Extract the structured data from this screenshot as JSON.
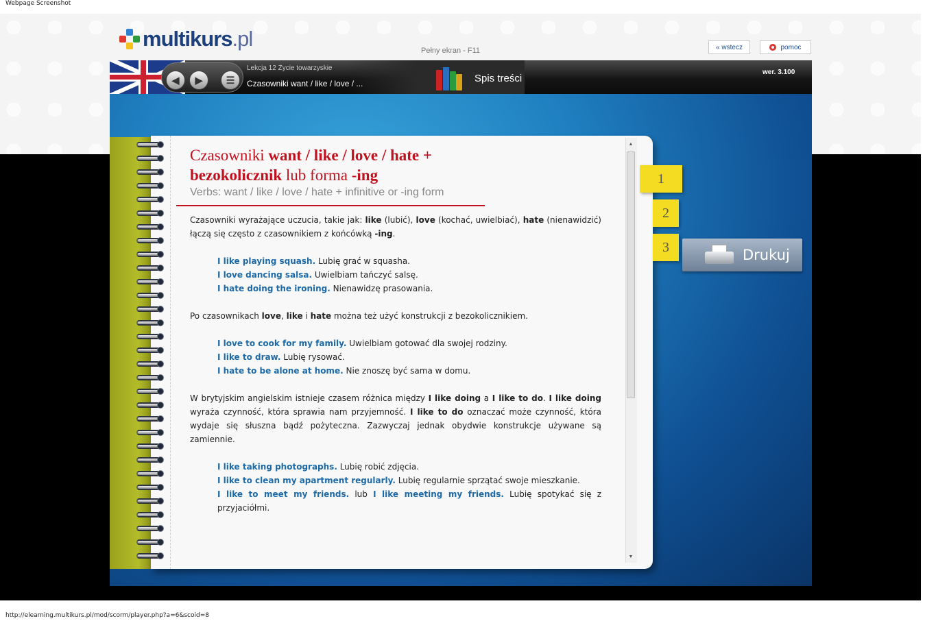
{
  "caption": {
    "top": "Webpage Screenshot",
    "bottom": "http://elearning.multikurs.pl/mod/scorm/player.php?a=6&scoid=8"
  },
  "header": {
    "logo_main": "multikurs",
    "logo_suffix": ".pl",
    "fullscreen_hint": "Pełny ekran - F11",
    "back_label": "« wstecz",
    "help_label": "pomoc"
  },
  "toolbar": {
    "lesson": "Lekcja 12 Życie towarzyskie",
    "topic": "Czasowniki want / like / love / ...",
    "toc_label": "Spis treści",
    "version": "wer. 3.100",
    "prev_icon": "arrow-left-icon",
    "next_icon": "arrow-right-icon",
    "menu_icon": "list-icon"
  },
  "content": {
    "title_part1": "Czasowniki ",
    "title_bold1": "want / like / love / hate + bezokolicznik",
    "title_part2": " lub forma ",
    "title_bold2": "-ing",
    "subtitle": "Verbs: want / like / love / hate + infinitive or -ing form",
    "intro": {
      "t1": "Czasowniki wyrażające uczucia, takie jak: ",
      "b1": "like",
      "t2": " (lubić), ",
      "b2": "love",
      "t3": " (kochać, uwielbiać), ",
      "b3": "hate",
      "t4": " (nienawidzić) łączą się często z czasownikiem z końcówką ",
      "b4": "-ing",
      "t5": "."
    },
    "examples1": [
      {
        "en": "I like playing squash.",
        "pl": " Lubię grać w squasha."
      },
      {
        "en": "I love dancing salsa.",
        "pl": " Uwielbiam tańczyć salsę."
      },
      {
        "en": "I hate doing the ironing.",
        "pl": " Nienawidzę prasowania."
      }
    ],
    "para2": {
      "t1": "Po czasownikach ",
      "b1": "love",
      "t2": ", ",
      "b2": "like",
      "t3": " i ",
      "b3": "hate",
      "t4": " można też użyć konstrukcji z bezokolicznikiem."
    },
    "examples2": [
      {
        "en": "I love to cook for my family.",
        "pl": " Uwielbiam gotować dla swojej rodziny."
      },
      {
        "en": "I like to draw.",
        "pl": " Lubię rysować."
      },
      {
        "en": "I hate to be alone at home.",
        "pl": " Nie znoszę być sama w domu."
      }
    ],
    "para3": {
      "t1": "W brytyjskim angielskim istnieje czasem różnica między ",
      "b1": "I like doing",
      "t2": " a ",
      "b2": "I like to do",
      "t3": ". ",
      "b3": "I like doing",
      "t4": " wyraża czynność, która sprawia nam przyjemność. ",
      "b4": "I like to do",
      "t5": " oznaczać może czynność, która wydaje się słuszna bądź pożyteczna. Zazwyczaj jednak obydwie konstrukcje używane są zamiennie."
    },
    "examples3": [
      {
        "en": "I like taking photographs.",
        "pl": " Lubię robić zdjęcia."
      },
      {
        "en": "I like to clean my apartment regularly.",
        "pl": " Lubię regularnie sprzątać swoje mieszkanie."
      }
    ],
    "example_last": {
      "en1": "I like to meet my friends.",
      "mid": " lub ",
      "en2": "I like meeting my friends.",
      "pl": " Lubię spotykać się z przyjaciółmi."
    }
  },
  "side": {
    "tabs": [
      "1",
      "2",
      "3"
    ],
    "print_label": "Drukuj",
    "print_icon": "printer-icon"
  },
  "colors": {
    "title_red": "#c0111f",
    "example_blue": "#1d6aa8",
    "tab_yellow": "#f3dc22"
  }
}
